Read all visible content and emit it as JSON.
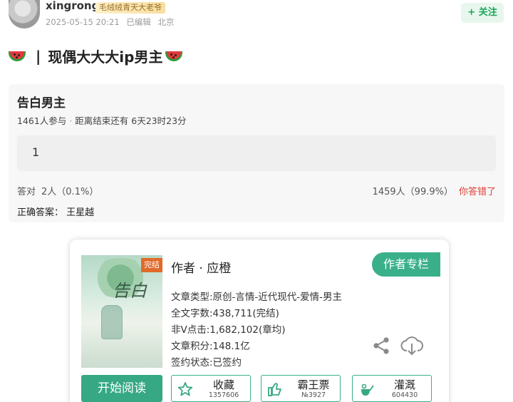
{
  "post": {
    "username": "xingrong",
    "badge": "毛绒绒青天大老爷",
    "date": "2025-05-15 20:21",
    "edited": "已编辑",
    "location": "北京",
    "follow_label": "+ 关注",
    "title": "现偶大大大ip男主",
    "title_separator": "|"
  },
  "quiz": {
    "title": "告白男主",
    "participants": "1461人参与",
    "dot": "·",
    "deadline": "距离结束还有 6天23时23分",
    "option": "1",
    "correct_label": "答对",
    "correct_stat": "2人（0.1%）",
    "wrong_stat": "1459人（99.9%）",
    "wrong_msg": "你答错了",
    "answer": "正确答案： 王星越"
  },
  "book": {
    "cover_ribbon": "完结",
    "cover_title": "告白",
    "author": "作者 · 应橙",
    "author_column": "作者专栏",
    "info": {
      "type": "文章类型:原创-言情-近代现代-爱情-男主",
      "words": "全文字数:438,711(完结)",
      "clicks": "非V点击:1,682,102(章均)",
      "score": "文章积分:148.1亿",
      "status": "签约状态:已签约"
    },
    "read_label": "开始阅读",
    "favorite": {
      "label": "收藏",
      "count": "1357606"
    },
    "vote": {
      "label": "霸王票",
      "count": "№3927"
    },
    "water": {
      "label": "灌溉",
      "count": "604430"
    }
  },
  "colors": {
    "accent_green": "#36a884",
    "follow_green": "#1aa65a",
    "wrong_red": "#d9423a"
  },
  "icons": [
    "watermelon-icon",
    "share-icon",
    "download-icon",
    "star-icon",
    "thumbs-up-icon",
    "watering-can-icon"
  ]
}
